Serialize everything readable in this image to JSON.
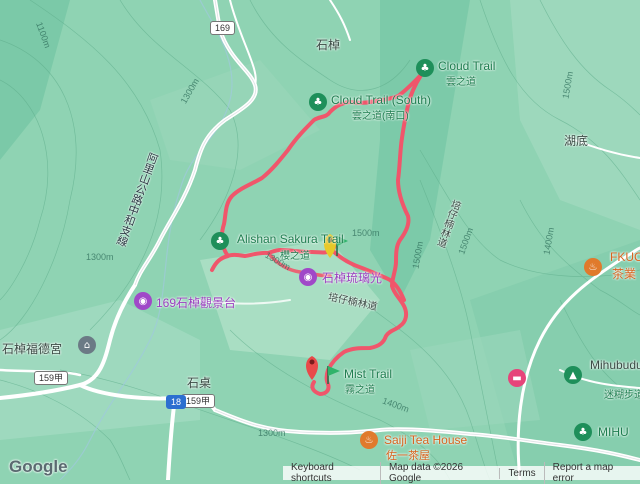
{
  "route_color": "#f0566b",
  "trail_labels": [
    {
      "name": "cloud-trail",
      "text": "Cloud Trail",
      "sub": "雲之道"
    },
    {
      "name": "cloud-trail-south",
      "text": "Cloud Trail (South)",
      "sub": "雲之道(南口)"
    },
    {
      "name": "alishan-sakura-trail",
      "text": "Alishan Sakura Trail",
      "sub": "櫻之道"
    },
    {
      "name": "mist-trail",
      "text": "Mist Trail",
      "sub": "霧之道"
    }
  ],
  "places": {
    "shizhuo": "石棹",
    "hudi": "湖底",
    "shizhuo_light": "石棹琉璃光",
    "observation_deck": "169石棹觀景台",
    "fude_temple": "石棹福德宮",
    "shizhuo_lower": "石桌",
    "peizai_forest_road": "培仔楠林道",
    "saiji_tea_house": "Saiji Tea House",
    "saiji_tea_house_zh": "佐一茶屋",
    "fkuc": "FKUC",
    "tea_industry": "茶業",
    "mihubudu": "Mihubudu",
    "mihu_trail": "迷糊步道",
    "mihu": "MIHU",
    "highway_name": "阿里山公路中和支線"
  },
  "road_shields": {
    "r169": "169",
    "r159a_1": "159甲",
    "r159a_2": "159甲",
    "r18": "18"
  },
  "contours": [
    "1100m",
    "1300m",
    "1300m",
    "1500m",
    "1400m",
    "1500m",
    "1500m",
    "1400m",
    "1300m",
    "1300m",
    "1500m"
  ],
  "attribution": {
    "keyboard": "Keyboard shortcuts",
    "map_data": "Map data ©2026 Google",
    "terms": "Terms",
    "report": "Report a map error"
  },
  "logo": "Google"
}
